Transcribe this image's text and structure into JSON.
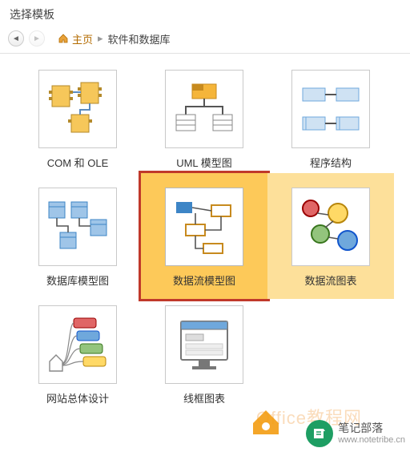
{
  "header": {
    "title": "选择模板"
  },
  "nav": {
    "home_label": "主页",
    "crumb_current": "软件和数据库",
    "separator": "▸"
  },
  "templates": [
    {
      "id": "com-ole",
      "label": "COM 和 OLE"
    },
    {
      "id": "uml",
      "label": "UML 模型图"
    },
    {
      "id": "prog",
      "label": "程序结构"
    },
    {
      "id": "db-model",
      "label": "数据库模型图"
    },
    {
      "id": "dataflow-model",
      "label": "数据流模型图",
      "selected": true
    },
    {
      "id": "dataflow-chart",
      "label": "数据流图表",
      "hover": true
    },
    {
      "id": "website",
      "label": "网站总体设计"
    },
    {
      "id": "wireframe",
      "label": "线框图表"
    }
  ],
  "watermark": {
    "ghost": "Office教程网",
    "name": "笔记部落",
    "url": "www.notetribe.cn"
  }
}
